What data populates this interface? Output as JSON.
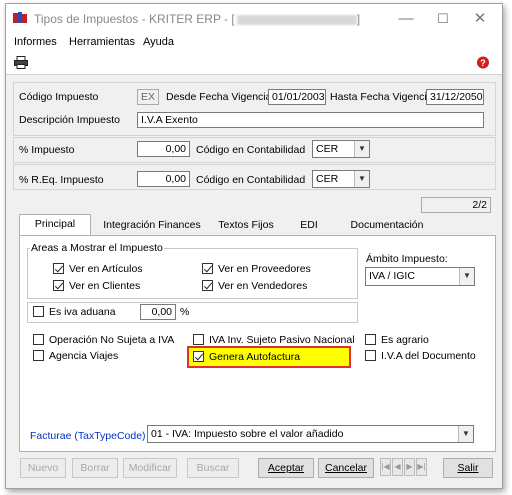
{
  "window": {
    "title": "Tipos de Impuestos - KRITER ERP - [",
    "title_end": "]",
    "min": "—",
    "max": "☐",
    "close": "✕"
  },
  "menu": [
    "Informes",
    "Herramientas",
    "Ayuda"
  ],
  "header": {
    "codigo_label": "Código Impuesto",
    "codigo_value": "EX",
    "desde_label": "Desde Fecha Vigencia",
    "desde_value": "01/01/2003",
    "hasta_label": "Hasta Fecha Vigencia",
    "hasta_value": "31/12/2050",
    "descripcion_label": "Descripción Impuesto",
    "descripcion_value": "I.V.A Exento",
    "pct_label": "% Impuesto",
    "pct_value": "0,00",
    "contab_label": "Código en Contabilidad",
    "contab_value": "CER",
    "req_label": "% R.Eq. Impuesto",
    "req_value": "0,00",
    "contab2_label": "Código en Contabilidad",
    "contab2_value": "CER",
    "record_counter": "2/2"
  },
  "tabs": [
    "Principal",
    "Integración Finances",
    "Textos Fijos",
    "EDI",
    "Documentación"
  ],
  "principal": {
    "areas_title": "Areas a Mostrar el Impuesto",
    "ver_articulos": "Ver en Artículos",
    "ver_clientes": "Ver en Clientes",
    "ver_proveedores": "Ver en Proveedores",
    "ver_vendedores": "Ver en Vendedores",
    "ambito_label": "Ámbito Impuesto:",
    "ambito_value": "IVA / IGIC",
    "es_iva_aduana": "Es iva aduana",
    "aduana_value": "0,00",
    "aduana_unit": "%",
    "op_no_sujeta": "Operación No Sujeta a IVA",
    "iva_inv": "IVA Inv. Sujeto Pasivo Nacional",
    "es_agrario": "Es agrario",
    "agencia_viajes": "Agencia Viajes",
    "genera_autofactura": "Genera Autofactura",
    "iva_documento": "I.V.A del Documento",
    "facturae_label": "Facturae (TaxTypeCode)",
    "facturae_value": "01 - IVA: Impuesto sobre el valor añadido"
  },
  "buttons": {
    "nuevo": "Nuevo",
    "borrar": "Borrar",
    "modificar": "Modificar",
    "buscar": "Buscar",
    "aceptar": "Aceptar",
    "cancelar": "Cancelar",
    "salir": "Salir"
  },
  "colors": {
    "highlight": "#ffff00",
    "highlight_border": "#e03030",
    "link_blue": "#0033cc"
  }
}
